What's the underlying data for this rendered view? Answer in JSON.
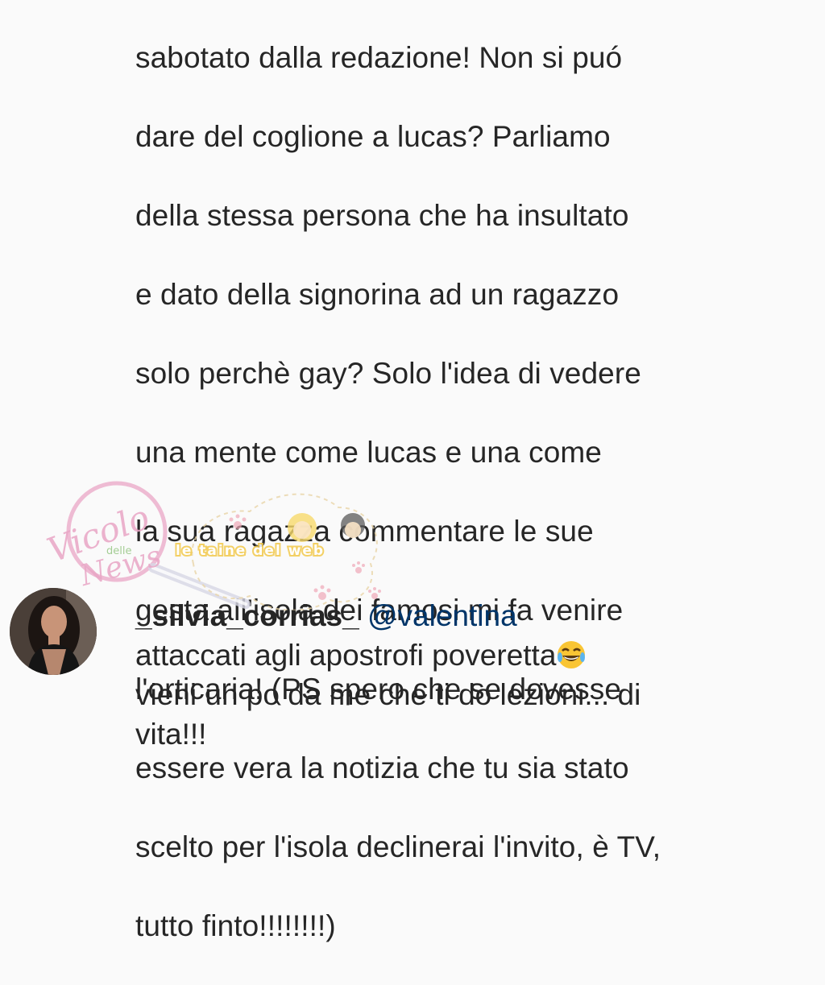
{
  "comment": {
    "lines": [
      "sabotato dalla redazione! Non si puó",
      "dare del coglione a lucas? Parliamo",
      "della stessa persona che ha insultato",
      "e dato della signorina ad un ragazzo",
      "solo perchè gay? Solo l'idea di vedere",
      "una mente come lucas e una come",
      "la sua ragazza commentare le sue",
      "gesta all'isola dei famosi mi fa venire",
      "l'orticaria! (PS spero che se dovesse",
      "essere vera la notizia che tu sia stato",
      "scelto per l'isola declinerai l'invito, è TV,",
      "tutto finto!!!!!!!!)"
    ]
  },
  "watermark": {
    "logo_text_1": "Vicolo",
    "logo_text_2": "delle",
    "logo_text_3": "News",
    "banner_text": "le taine del web"
  },
  "reply": {
    "username": "_silvia_corrias_",
    "mention": "@valentina",
    "line1": "attaccati agli apostrofi poveretta",
    "line2": "vieni un po da me che ti do lezioni... di",
    "line3": "vita!!!",
    "emoji_icon": "tears-of-joy-emoji"
  },
  "colors": {
    "text": "#262626",
    "mention": "#003569",
    "background": "#fafafa",
    "watermark_pink": "#e9a6c6"
  }
}
